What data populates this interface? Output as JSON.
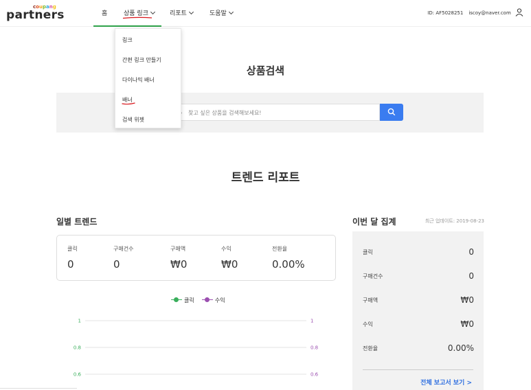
{
  "header": {
    "logo_brand_letters": [
      "c",
      "o",
      "u",
      "p",
      "a",
      "n",
      "g"
    ],
    "logo_brand_colors": [
      "#8a2b1f",
      "#e04b1b",
      "#f3a51a",
      "#7fba2b",
      "#2da9e1",
      "#d54b9e",
      "#f2c21b"
    ],
    "logo_word": "partners",
    "nav": {
      "home": "홈",
      "product_link": "상품 링크",
      "report": "리포트",
      "help": "도움말"
    },
    "account_id": "ID: AF5028251",
    "account_email": "iscoy@naver.com",
    "accent_color": "#2ea24a",
    "annotation_color": "#d9161b"
  },
  "dropdown": {
    "items": [
      "링크",
      "간편 링크 만들기",
      "다이나믹 배너",
      "배너",
      "검색 위젯"
    ]
  },
  "search": {
    "title": "상품검색",
    "placeholder": "찾고 싶은 상품을 검색해보세요!",
    "button_icon": "search-icon",
    "button_color": "#3a7cf0"
  },
  "trend": {
    "title": "트렌드 리포트"
  },
  "daily": {
    "title": "일별 트렌드",
    "metrics": [
      {
        "label": "클릭",
        "value": "0"
      },
      {
        "label": "구매건수",
        "value": "0"
      },
      {
        "label": "구매액",
        "value": "₩0"
      },
      {
        "label": "수익",
        "value": "₩0"
      },
      {
        "label": "전환율",
        "value": "0.00%"
      }
    ],
    "legend": [
      {
        "name": "클릭",
        "color": "#3aae5c"
      },
      {
        "name": "수익",
        "color": "#9b4fb0"
      }
    ]
  },
  "chart_data": {
    "type": "line",
    "series": [
      {
        "name": "클릭",
        "values": []
      },
      {
        "name": "수익",
        "values": []
      }
    ],
    "left_ticks": [
      "1",
      "0.8",
      "0.6"
    ],
    "right_ticks": [
      "1",
      "0.8",
      "0.6"
    ],
    "left_tick_color": "#3aae5c",
    "right_tick_color": "#9b4fb0",
    "ylim": [
      0,
      1
    ],
    "grid": true
  },
  "monthly": {
    "title": "이번 달 집계",
    "updated": "최근 업데이트: 2019-08-23",
    "rows": [
      {
        "label": "클릭",
        "value": "0"
      },
      {
        "label": "구매건수",
        "value": "0"
      },
      {
        "label": "구매액",
        "value": "₩0"
      },
      {
        "label": "수익",
        "value": "₩0"
      },
      {
        "label": "전환율",
        "value": "0.00%"
      }
    ],
    "full_report_link": "전체 보고서 보기 >"
  }
}
